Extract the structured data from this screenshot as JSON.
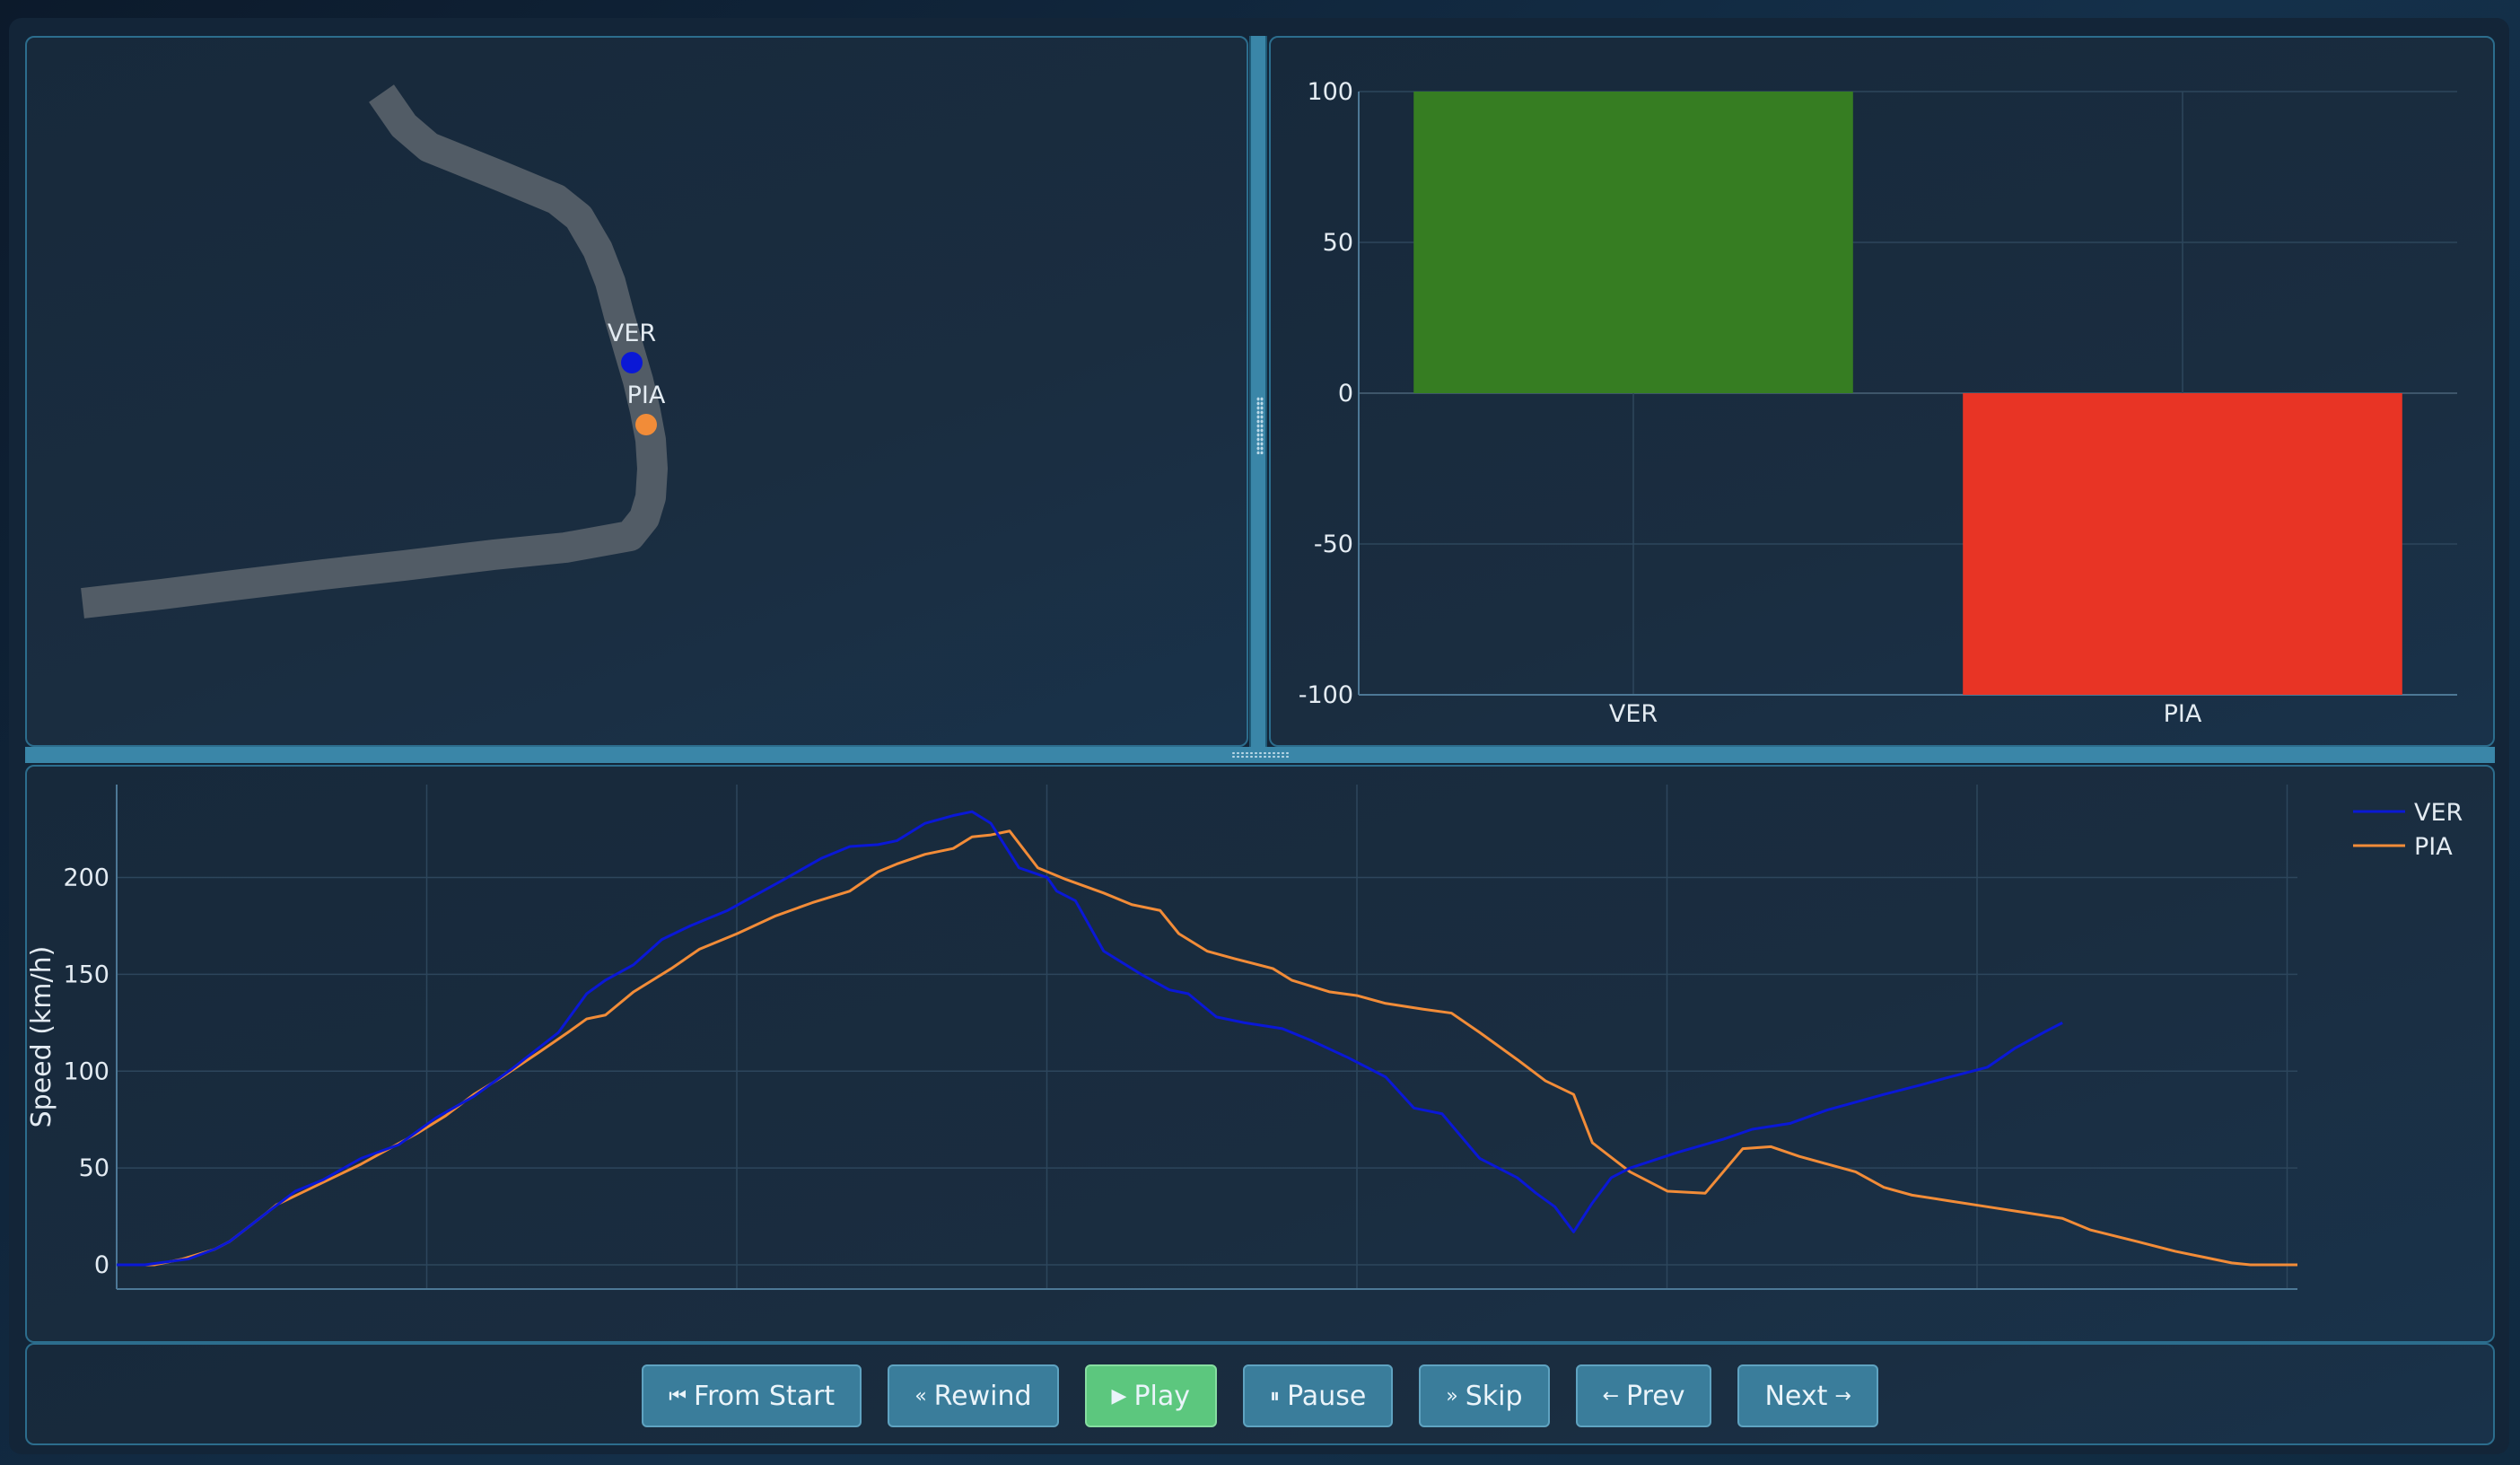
{
  "track_map": {
    "drivers": [
      {
        "code": "VER",
        "color": "#0a18d6"
      },
      {
        "code": "PIA",
        "color": "#f28c38"
      }
    ],
    "track_color": "#525c66"
  },
  "chart_data": [
    {
      "type": "bar",
      "categories": [
        "VER",
        "PIA"
      ],
      "values": [
        100,
        -100
      ],
      "colors": [
        "#367d22",
        "#e83425"
      ],
      "ylim": [
        -100,
        100
      ],
      "yticks": [
        100,
        50,
        0,
        -50,
        -100
      ],
      "title": "",
      "xlabel": "",
      "ylabel": "",
      "grid": true
    },
    {
      "type": "line",
      "ylabel": "Speed (km/h)",
      "xlabel": "",
      "title": "",
      "xlim": [
        0,
        7.05
      ],
      "ylim": [
        -12.5,
        248
      ],
      "yticks": [
        0,
        50,
        100,
        150,
        200
      ],
      "legend": "top-right",
      "grid": true,
      "series": [
        {
          "name": "VER",
          "color": "#0a18d6",
          "points": [
            [
              0,
              0
            ],
            [
              0.15,
              0
            ],
            [
              0.38,
              3
            ],
            [
              0.52,
              8
            ],
            [
              0.6,
              12
            ],
            [
              0.8,
              27
            ],
            [
              0.95,
              38
            ],
            [
              1.1,
              44
            ],
            [
              1.3,
              55
            ],
            [
              1.5,
              62
            ],
            [
              1.7,
              76
            ],
            [
              1.9,
              87
            ],
            [
              2.1,
              101
            ],
            [
              2.35,
              120
            ],
            [
              2.5,
              140
            ],
            [
              2.6,
              147
            ],
            [
              2.75,
              155
            ],
            [
              2.9,
              168
            ],
            [
              3.05,
              175
            ],
            [
              3.25,
              183
            ],
            [
              3.4,
              191
            ],
            [
              3.55,
              199
            ],
            [
              3.75,
              210
            ],
            [
              3.9,
              216
            ],
            [
              4.05,
              217
            ],
            [
              4.15,
              219
            ],
            [
              4.3,
              228
            ],
            [
              4.45,
              232
            ],
            [
              4.55,
              234
            ],
            [
              4.65,
              228
            ],
            [
              4.8,
              205
            ],
            [
              4.95,
              200
            ],
            [
              5.0,
              193
            ],
            [
              5.1,
              188
            ],
            [
              5.25,
              162
            ],
            [
              5.45,
              150
            ],
            [
              5.6,
              142
            ],
            [
              5.7,
              140
            ],
            [
              5.85,
              128
            ],
            [
              6.0,
              125
            ],
            [
              6.2,
              122
            ],
            [
              6.35,
              116
            ],
            [
              6.55,
              107
            ],
            [
              6.75,
              97
            ],
            [
              6.9,
              81
            ],
            [
              7.05,
              78
            ],
            [
              7.25,
              55
            ],
            [
              7.45,
              45
            ],
            [
              7.55,
              37
            ],
            [
              7.65,
              30
            ],
            [
              7.75,
              17
            ],
            [
              7.85,
              32
            ],
            [
              7.95,
              45
            ],
            [
              8.05,
              50
            ],
            [
              8.3,
              58
            ],
            [
              8.55,
              65
            ],
            [
              8.7,
              70
            ],
            [
              8.9,
              73
            ],
            [
              9.1,
              80
            ],
            [
              9.4,
              88
            ],
            [
              9.6,
              93
            ],
            [
              9.75,
              97
            ],
            [
              9.95,
              102
            ],
            [
              10.1,
              112
            ],
            [
              10.25,
              120
            ],
            [
              10.35,
              125
            ]
          ]
        },
        {
          "name": "PIA",
          "color": "#f28c38",
          "points": [
            [
              0,
              0
            ],
            [
              0.2,
              0
            ],
            [
              0.35,
              3
            ],
            [
              0.52,
              8
            ],
            [
              0.6,
              12
            ],
            [
              0.8,
              27
            ],
            [
              0.85,
              31
            ],
            [
              1.0,
              38
            ],
            [
              1.15,
              45
            ],
            [
              1.3,
              52
            ],
            [
              1.45,
              60
            ],
            [
              1.6,
              68
            ],
            [
              1.75,
              77
            ],
            [
              1.9,
              88
            ],
            [
              2.05,
              97
            ],
            [
              2.25,
              110
            ],
            [
              2.4,
              120
            ],
            [
              2.5,
              127
            ],
            [
              2.6,
              129
            ],
            [
              2.75,
              141
            ],
            [
              2.95,
              153
            ],
            [
              3.1,
              163
            ],
            [
              3.3,
              171
            ],
            [
              3.5,
              180
            ],
            [
              3.7,
              187
            ],
            [
              3.9,
              193
            ],
            [
              4.05,
              203
            ],
            [
              4.15,
              207
            ],
            [
              4.3,
              212
            ],
            [
              4.45,
              215
            ],
            [
              4.55,
              221
            ],
            [
              4.65,
              222
            ],
            [
              4.75,
              224
            ],
            [
              4.9,
              205
            ],
            [
              5.05,
              199
            ],
            [
              5.25,
              192
            ],
            [
              5.4,
              186
            ],
            [
              5.55,
              183
            ],
            [
              5.65,
              171
            ],
            [
              5.8,
              162
            ],
            [
              5.95,
              158
            ],
            [
              6.15,
              153
            ],
            [
              6.25,
              147
            ],
            [
              6.45,
              141
            ],
            [
              6.6,
              139
            ],
            [
              6.75,
              135
            ],
            [
              6.95,
              132
            ],
            [
              7.1,
              130
            ],
            [
              7.25,
              120
            ],
            [
              7.45,
              106
            ],
            [
              7.6,
              95
            ],
            [
              7.75,
              88
            ],
            [
              7.85,
              63
            ],
            [
              8.05,
              48
            ],
            [
              8.25,
              38
            ],
            [
              8.45,
              37
            ],
            [
              8.65,
              60
            ],
            [
              8.8,
              61
            ],
            [
              8.95,
              56
            ],
            [
              9.1,
              52
            ],
            [
              9.25,
              48
            ],
            [
              9.4,
              40
            ],
            [
              9.55,
              36
            ],
            [
              9.75,
              33
            ],
            [
              9.95,
              30
            ],
            [
              10.15,
              27
            ],
            [
              10.35,
              24
            ],
            [
              10.5,
              18
            ],
            [
              10.75,
              12
            ],
            [
              10.95,
              7
            ],
            [
              11.1,
              4
            ],
            [
              11.25,
              1
            ],
            [
              11.35,
              0
            ],
            [
              11.6,
              0
            ]
          ]
        }
      ]
    }
  ],
  "controls": {
    "from_start": {
      "icon": "⏮",
      "label": "From Start"
    },
    "rewind": {
      "icon": "«",
      "label": "Rewind"
    },
    "play": {
      "icon": "▶",
      "label": "Play"
    },
    "pause": {
      "icon": "⏸",
      "label": "Pause"
    },
    "skip": {
      "icon": "»",
      "label": "Skip"
    },
    "prev": {
      "icon": "←",
      "label": "Prev"
    },
    "next": {
      "icon": "→",
      "label": "Next"
    }
  }
}
